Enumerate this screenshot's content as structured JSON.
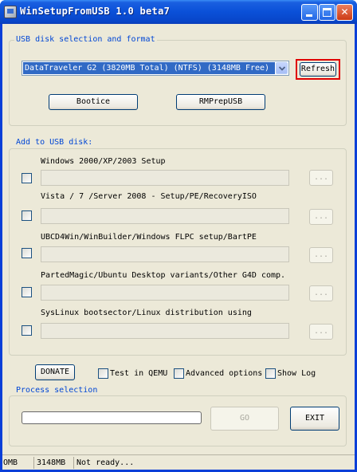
{
  "window": {
    "title": "WinSetupFromUSB 1.0 beta7"
  },
  "usb_group": {
    "title": "USB disk selection and format",
    "disk_selected": "DataTraveler G2 (3820MB Total) (NTFS) (3148MB Free)",
    "refresh_label": "Refresh",
    "bootice_label": "Bootice",
    "rmprepusb_label": "RMPrepUSB"
  },
  "add_group": {
    "title": "Add to USB disk:",
    "items": [
      {
        "label": "Windows 2000/XP/2003 Setup",
        "checked": false,
        "path": "",
        "browse": "..."
      },
      {
        "label": "Vista / 7 /Server 2008 - Setup/PE/RecoveryISO",
        "checked": false,
        "path": "",
        "browse": "..."
      },
      {
        "label": "UBCD4Win/WinBuilder/Windows FLPC setup/BartPE",
        "checked": false,
        "path": "",
        "browse": "..."
      },
      {
        "label": "PartedMagic/Ubuntu Desktop variants/Other G4D comp.",
        "checked": false,
        "path": "",
        "browse": "..."
      },
      {
        "label": "SysLinux bootsector/Linux distribution using",
        "checked": false,
        "path": "",
        "browse": "..."
      }
    ]
  },
  "options": {
    "donate_label": "DONATE",
    "test_qemu_label": "Test in QEMU",
    "advanced_label": "Advanced options",
    "show_log_label": "Show Log"
  },
  "process_group": {
    "title": "Process selection",
    "progress_percent": 0,
    "go_label": "GO",
    "exit_label": "EXIT"
  },
  "statusbar": {
    "cell1": "OMB",
    "cell2": "3148MB",
    "cell3": "Not ready..."
  },
  "colors": {
    "titlebar": "#0a50d8",
    "group_title": "#0046d5",
    "highlight": "#316ac5",
    "refresh_outline": "#e00000",
    "face": "#ece9d8"
  }
}
